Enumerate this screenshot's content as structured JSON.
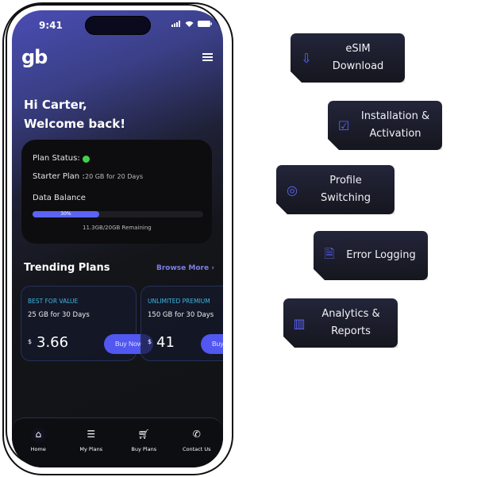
{
  "status_bar": {
    "time": "9:41"
  },
  "brand": {
    "logo": "gb"
  },
  "greeting": {
    "line1": "Hi Carter,",
    "line2": "Welcome back!"
  },
  "plan": {
    "status_label": "Plan Status:",
    "status_color": "#3fd14a",
    "plan_label": "Starter Plan :",
    "plan_value": "20 GB for 20 Days",
    "balance_label": "Data Balance",
    "progress_percent": 30,
    "progress_label": "30%",
    "remaining": "11.3GB/20GB  Remaining"
  },
  "trending": {
    "title": "Trending Plans",
    "browse": "Browse More",
    "offers": [
      {
        "tag": "BEST FOR VALUE",
        "desc": "25 GB for 30 Days",
        "currency": "$",
        "price": "3.66",
        "button": "Buy Now"
      },
      {
        "tag": "UNLIMITED PREMIUM",
        "desc": "150 GB for 30 Days",
        "currency": "$",
        "price": "41",
        "button": "Buy Now"
      }
    ]
  },
  "nav": [
    {
      "label": "Home",
      "icon": "home-icon"
    },
    {
      "label": "My Plans",
      "icon": "checklist-icon"
    },
    {
      "label": "Buy Plans",
      "icon": "cart-icon"
    },
    {
      "label": "Contact Us",
      "icon": "phone-icon"
    }
  ],
  "features": [
    {
      "label": "eSIM Download",
      "icon": "sim-download-icon"
    },
    {
      "label": "Installation & Activation",
      "icon": "activation-check-icon"
    },
    {
      "label": "Profile Switching",
      "icon": "user-circle-icon"
    },
    {
      "label": "Error Logging",
      "icon": "file-error-icon"
    },
    {
      "label": "Analytics & Reports",
      "icon": "bar-chart-icon"
    }
  ],
  "colors": {
    "accent": "#5b64f4",
    "tag": "#3fb7e0"
  }
}
